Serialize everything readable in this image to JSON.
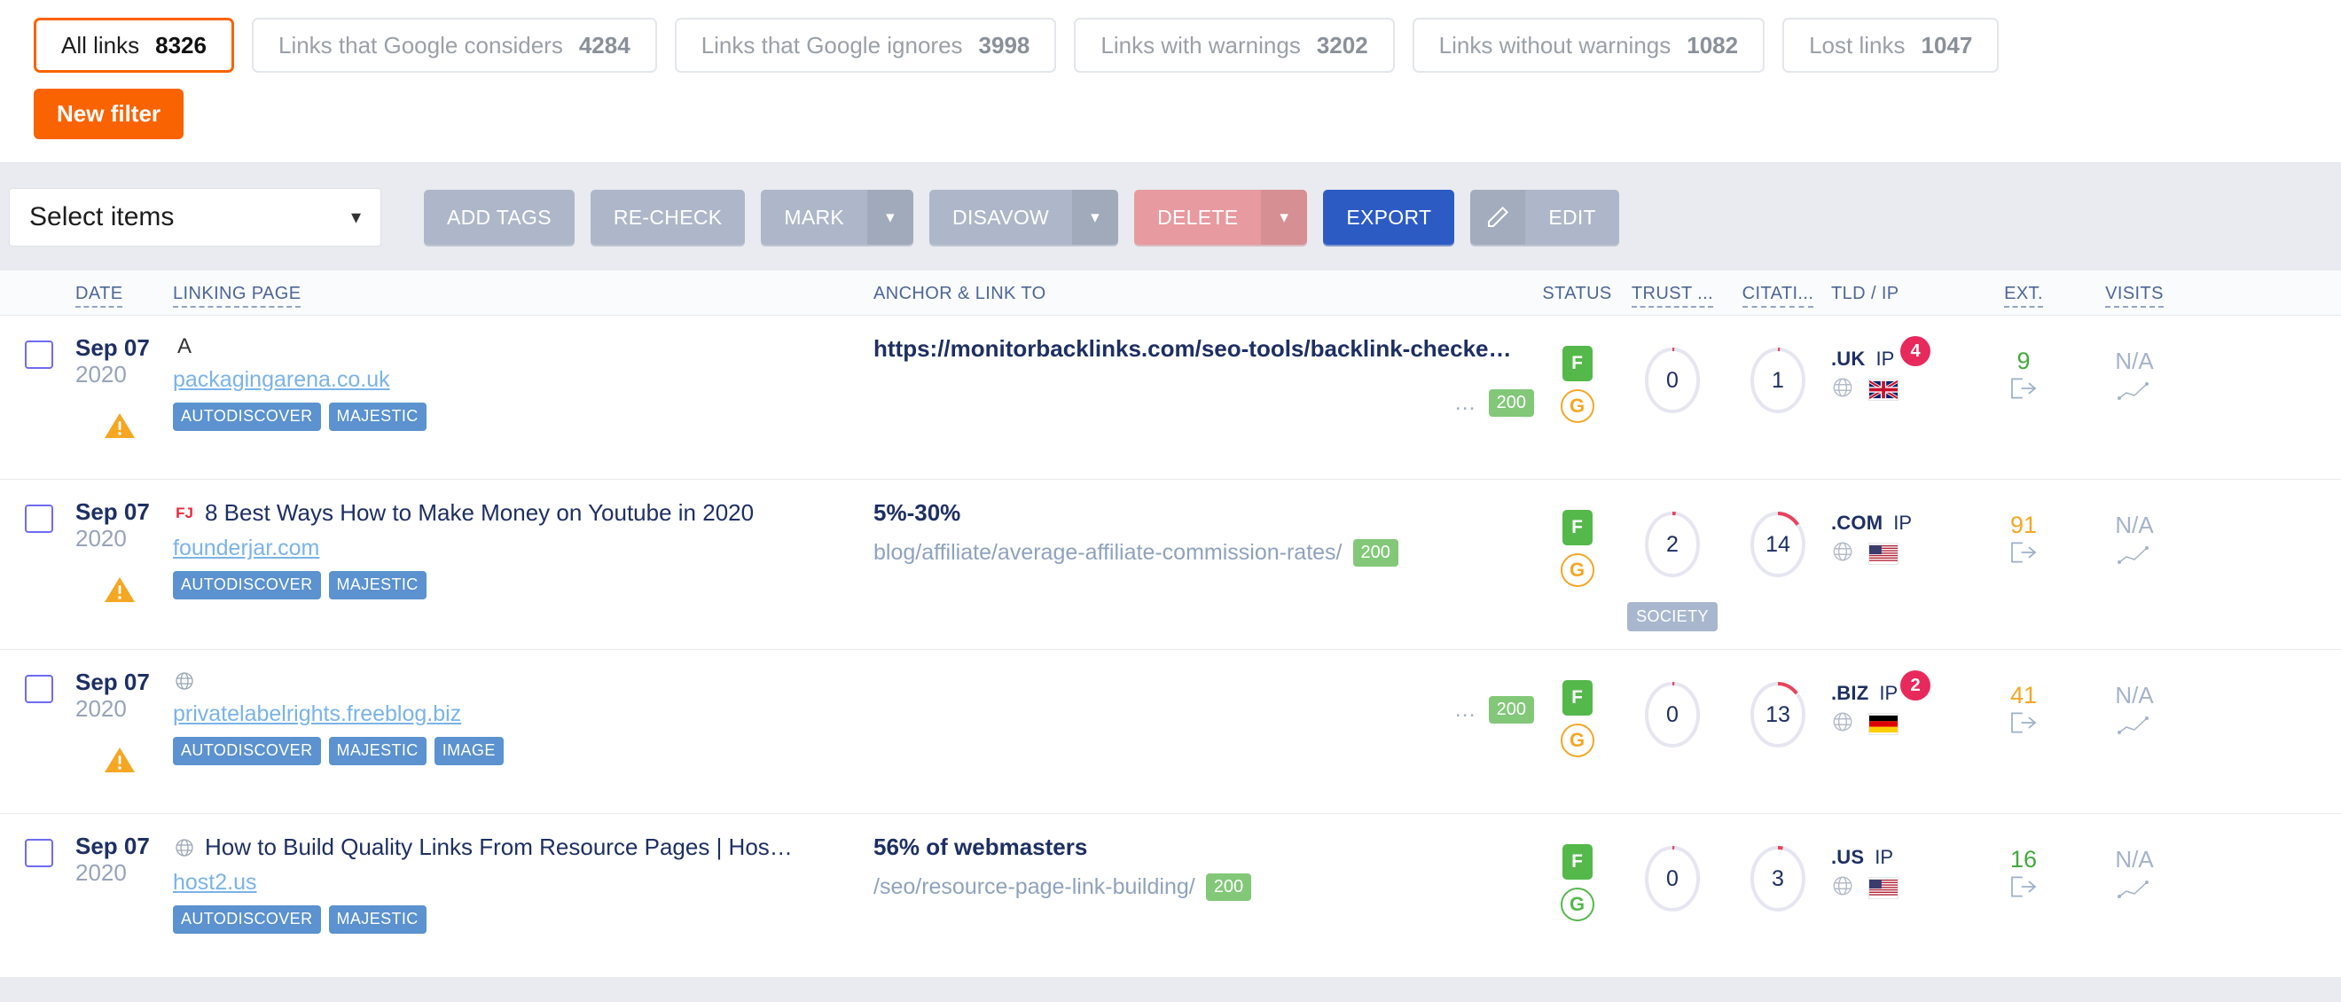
{
  "filters": {
    "tabs": [
      {
        "label": "All links",
        "count": "8326",
        "active": true
      },
      {
        "label": "Links that Google considers",
        "count": "4284",
        "active": false
      },
      {
        "label": "Links that Google ignores",
        "count": "3998",
        "active": false
      },
      {
        "label": "Links with warnings",
        "count": "3202",
        "active": false
      },
      {
        "label": "Links without warnings",
        "count": "1082",
        "active": false
      },
      {
        "label": "Lost links",
        "count": "1047",
        "active": false
      }
    ],
    "new_filter_label": "New filter",
    "accent_color": "#f96302"
  },
  "toolbar": {
    "select_items_label": "Select items",
    "add_tags_label": "ADD TAGS",
    "recheck_label": "RE-CHECK",
    "mark_label": "MARK",
    "disavow_label": "DISAVOW",
    "delete_label": "DELETE",
    "export_label": "EXPORT",
    "edit_label": "EDIT",
    "delete_color": "#e79a9f",
    "export_color": "#2c5bc4"
  },
  "table": {
    "headers": {
      "date": "DATE",
      "linking_page": "LINKING PAGE",
      "anchor_link_to": "ANCHOR & LINK TO",
      "status": "STATUS",
      "trust": "TRUST ...",
      "citation": "CITATI...",
      "tld_ip": "TLD / IP",
      "ext": "EXT.",
      "visits": "VISITS"
    },
    "rows": [
      {
        "date_main": "Sep 07",
        "date_year": "2020",
        "has_warning": true,
        "favicon": "letter-a-icon",
        "favicon_letter": "A",
        "title": "",
        "domain": "packagingarena.co.uk",
        "tags": [
          "AUTODISCOVER",
          "MAJESTIC"
        ],
        "anchor_text": "https://monitorbacklinks.com/seo-tools/backlink-checke…",
        "anchor_url": "",
        "show_dots": true,
        "http_code": "200",
        "status_f": "F",
        "status_g": "G",
        "status_g_color": "orange",
        "trust": "0",
        "trust_pct": 0,
        "citation": "1",
        "citation_pct": 1,
        "category_tag": "",
        "tld": ".UK",
        "ip_label": "IP",
        "ip_count": "4",
        "flag": "uk",
        "ext": "9",
        "ext_color": "green",
        "visits": "N/A"
      },
      {
        "date_main": "Sep 07",
        "date_year": "2020",
        "has_warning": true,
        "favicon": "founderjar-icon",
        "favicon_letter": "FJ",
        "title": "8 Best Ways How to Make Money on Youtube in 2020",
        "domain": "founderjar.com",
        "tags": [
          "AUTODISCOVER",
          "MAJESTIC"
        ],
        "anchor_text": "5%-30%",
        "anchor_url": "blog/affiliate/average-affiliate-commission-rates/",
        "show_dots": false,
        "http_code": "200",
        "status_f": "F",
        "status_g": "G",
        "status_g_color": "orange",
        "trust": "2",
        "trust_pct": 2,
        "citation": "14",
        "citation_pct": 14,
        "category_tag": "SOCIETY",
        "tld": ".COM",
        "ip_label": "IP",
        "ip_count": "",
        "flag": "us",
        "ext": "91",
        "ext_color": "orange",
        "visits": "N/A"
      },
      {
        "date_main": "Sep 07",
        "date_year": "2020",
        "has_warning": true,
        "favicon": "globe-icon",
        "favicon_letter": "",
        "title": "",
        "domain": "privatelabelrights.freeblog.biz",
        "tags": [
          "AUTODISCOVER",
          "MAJESTIC",
          "IMAGE"
        ],
        "anchor_text": "",
        "anchor_url": "",
        "show_dots": true,
        "http_code": "200",
        "status_f": "F",
        "status_g": "G",
        "status_g_color": "orange",
        "trust": "0",
        "trust_pct": 0,
        "citation": "13",
        "citation_pct": 13,
        "category_tag": "",
        "tld": ".BIZ",
        "ip_label": "IP",
        "ip_count": "2",
        "flag": "de",
        "ext": "41",
        "ext_color": "orange",
        "visits": "N/A"
      },
      {
        "date_main": "Sep 07",
        "date_year": "2020",
        "has_warning": false,
        "favicon": "globe-icon",
        "favicon_letter": "",
        "title": "How to Build Quality Links From Resource Pages | Hos…",
        "domain": "host2.us",
        "tags": [
          "AUTODISCOVER",
          "MAJESTIC"
        ],
        "anchor_text": "56% of webmasters",
        "anchor_url": "/seo/resource-page-link-building/",
        "show_dots": false,
        "http_code": "200",
        "status_f": "F",
        "status_g": "G",
        "status_g_color": "green",
        "trust": "0",
        "trust_pct": 0,
        "citation": "3",
        "citation_pct": 3,
        "category_tag": "",
        "tld": ".US",
        "ip_label": "IP",
        "ip_count": "",
        "flag": "us",
        "ext": "16",
        "ext_color": "green",
        "visits": "N/A"
      }
    ]
  }
}
